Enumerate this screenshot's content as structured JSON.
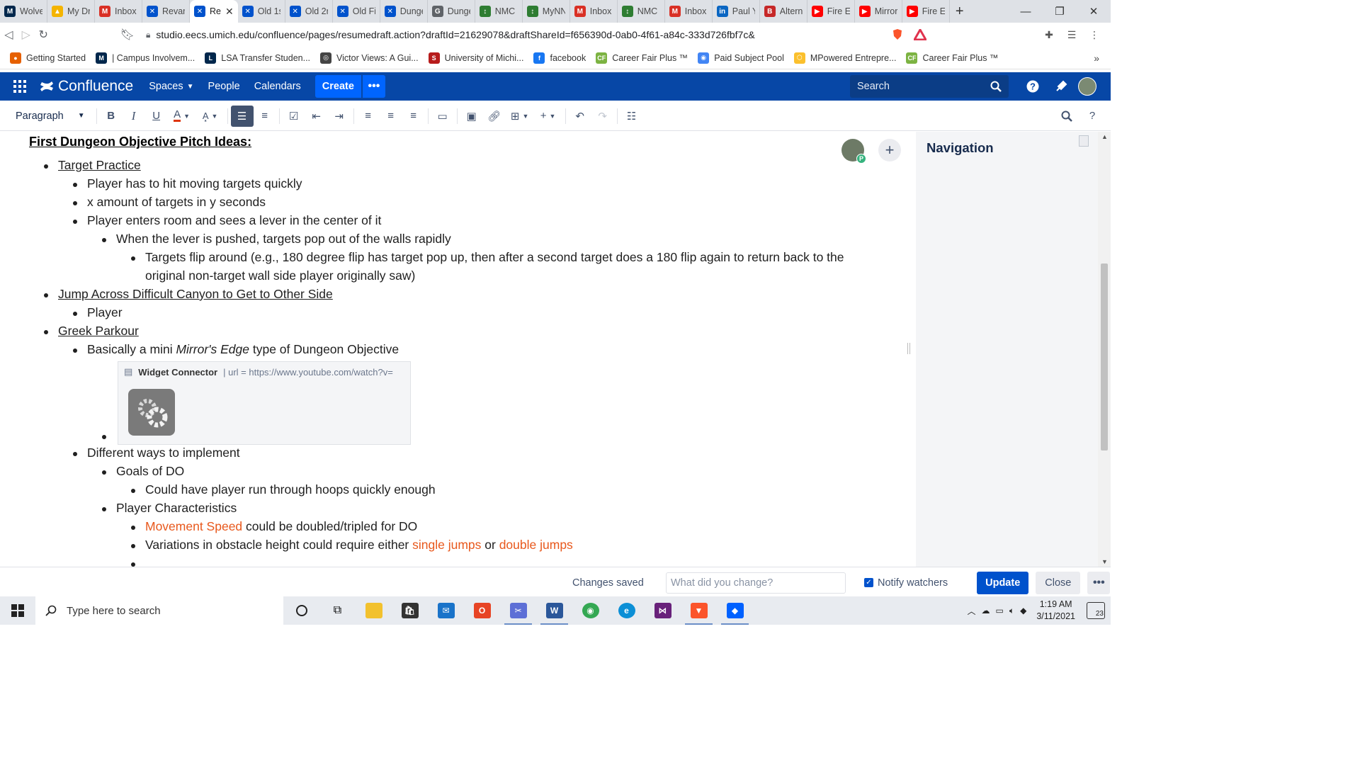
{
  "browser": {
    "tabs": [
      {
        "label": "Wolve",
        "icon": "michigan-icon",
        "color": "#00274c",
        "glyph": "M"
      },
      {
        "label": "My Dr",
        "icon": "drive-icon",
        "color": "#f4b400",
        "glyph": "▲"
      },
      {
        "label": "Inbox",
        "icon": "gmail-icon",
        "color": "#d93025",
        "glyph": "M"
      },
      {
        "label": "Revam",
        "icon": "confluence-icon",
        "color": "#0052cc",
        "glyph": "✕"
      },
      {
        "label": "Re",
        "icon": "confluence-icon",
        "color": "#0052cc",
        "glyph": "✕",
        "active": true
      },
      {
        "label": "Old 1s",
        "icon": "confluence-icon",
        "color": "#0052cc",
        "glyph": "✕"
      },
      {
        "label": "Old 2r",
        "icon": "confluence-icon",
        "color": "#0052cc",
        "glyph": "✕"
      },
      {
        "label": "Old Fi",
        "icon": "confluence-icon",
        "color": "#0052cc",
        "glyph": "✕"
      },
      {
        "label": "Dunge",
        "icon": "confluence-icon",
        "color": "#0052cc",
        "glyph": "✕"
      },
      {
        "label": "Dunge",
        "icon": "google-icon",
        "color": "#5f6368",
        "glyph": "G"
      },
      {
        "label": "NMC",
        "icon": "nmc-icon",
        "color": "#2e7d32",
        "glyph": "↕"
      },
      {
        "label": "MyNN",
        "icon": "nmc-icon",
        "color": "#2e7d32",
        "glyph": "↕"
      },
      {
        "label": "Inbox",
        "icon": "gmail-icon",
        "color": "#d93025",
        "glyph": "M"
      },
      {
        "label": "NMC",
        "icon": "nmc-icon",
        "color": "#2e7d32",
        "glyph": "↕"
      },
      {
        "label": "Inbox",
        "icon": "gmail-icon",
        "color": "#d93025",
        "glyph": "M"
      },
      {
        "label": "Paul Y",
        "icon": "linkedin-icon",
        "color": "#0a66c2",
        "glyph": "in"
      },
      {
        "label": "Altern",
        "icon": "b-icon",
        "color": "#c62828",
        "glyph": "B"
      },
      {
        "label": "Fire Er",
        "icon": "youtube-icon",
        "color": "#ff0000",
        "glyph": "▶"
      },
      {
        "label": "Mirror",
        "icon": "youtube-icon",
        "color": "#ff0000",
        "glyph": "▶"
      },
      {
        "label": "Fire Er",
        "icon": "youtube-icon",
        "color": "#ff0000",
        "glyph": "▶"
      }
    ],
    "url": "studio.eecs.umich.edu/confluence/pages/resumedraft.action?draftId=21629078&draftShareId=f656390d-0ab0-4f61-a84c-333d726fbf7c&",
    "brave_badge": "6",
    "bookmarks": [
      {
        "label": "Getting Started",
        "icon": "firefox-icon",
        "color": "#e66000",
        "glyph": "●"
      },
      {
        "label": "| Campus Involvem...",
        "icon": "michigan-icon",
        "color": "#00274c",
        "glyph": "M"
      },
      {
        "label": "LSA Transfer Studen...",
        "icon": "lsa-icon",
        "color": "#00274c",
        "glyph": "L"
      },
      {
        "label": "Victor Views: A Gui...",
        "icon": "globe-icon",
        "color": "#444444",
        "glyph": "◎"
      },
      {
        "label": "University of Michi...",
        "icon": "umich-icon",
        "color": "#b71c1c",
        "glyph": "S"
      },
      {
        "label": "facebook",
        "icon": "facebook-icon",
        "color": "#1877f2",
        "glyph": "f"
      },
      {
        "label": "Career Fair Plus ™",
        "icon": "careerfair-icon",
        "color": "#7cb342",
        "glyph": "CF"
      },
      {
        "label": "Paid Subject Pool",
        "icon": "chrome-icon",
        "color": "#4285f4",
        "glyph": "◉"
      },
      {
        "label": "MPowered Entrepre...",
        "icon": "hexagon-icon",
        "color": "#fbc02d",
        "glyph": "⬡"
      },
      {
        "label": "Career Fair Plus ™",
        "icon": "careerfair-icon",
        "color": "#7cb342",
        "glyph": "CF"
      }
    ]
  },
  "confluence": {
    "brand": "Confluence",
    "nav": {
      "spaces": "Spaces",
      "people": "People",
      "calendars": "Calendars"
    },
    "create": "Create",
    "search_placeholder": "Search"
  },
  "toolbar": {
    "paragraph_style": "Paragraph"
  },
  "editor": {
    "heading": "First Dungeon Objective Pitch Ideas:",
    "collaborator_badge": "P",
    "items": [
      {
        "level": 1,
        "segments": [
          {
            "text": "Target Practice",
            "style": "u"
          }
        ]
      },
      {
        "level": 2,
        "segments": [
          {
            "text": "Player has to hit moving targets quickly"
          }
        ]
      },
      {
        "level": 2,
        "segments": [
          {
            "text": "x amount of targets in y seconds"
          }
        ]
      },
      {
        "level": 2,
        "segments": [
          {
            "text": "Player enters room and sees a lever in the center of it"
          }
        ]
      },
      {
        "level": 3,
        "segments": [
          {
            "text": "When the lever is pushed, targets pop out of the walls rapidly"
          }
        ]
      },
      {
        "level": 4,
        "segments": [
          {
            "text": "Targets flip around (e.g., 180 degree flip has target pop up, then after a second target does a 180 flip again to return back to the"
          }
        ]
      },
      {
        "level": 4,
        "continuation": true,
        "segments": [
          {
            "text": "original non-target wall side player originally saw)"
          }
        ]
      },
      {
        "level": 1,
        "segments": [
          {
            "text": "Jump Across Difficult Canyon to Get to Other Side",
            "style": "u"
          }
        ]
      },
      {
        "level": 2,
        "segments": [
          {
            "text": "Player"
          }
        ]
      },
      {
        "level": 1,
        "segments": [
          {
            "text": "Greek Parkour",
            "style": "u"
          }
        ]
      },
      {
        "level": 2,
        "segments": [
          {
            "text": "Basically a mini "
          },
          {
            "text": "Mirror's Edge",
            "style": "i"
          },
          {
            "text": " type of Dungeon Objective"
          }
        ]
      },
      {
        "level": 2,
        "segments": [
          {
            "text": "Different ways to implement"
          }
        ]
      },
      {
        "level": 3,
        "segments": [
          {
            "text": "Goals of DO"
          }
        ]
      },
      {
        "level": 4,
        "segments": [
          {
            "text": "Could have player run through hoops quickly enough"
          }
        ]
      },
      {
        "level": 3,
        "segments": [
          {
            "text": "Player Characteristics"
          }
        ]
      },
      {
        "level": 4,
        "segments": [
          {
            "text": "Movement Speed",
            "style": "orange"
          },
          {
            "text": " could be doubled/tripled for DO"
          }
        ]
      },
      {
        "level": 4,
        "segments": [
          {
            "text": "Variations in obstacle height could require either "
          },
          {
            "text": "single jumps",
            "style": "orange"
          },
          {
            "text": " or "
          },
          {
            "text": "double jumps",
            "style": "orange"
          }
        ]
      },
      {
        "level": 4,
        "segments": []
      }
    ],
    "widget": {
      "title": "Widget Connector",
      "url": "| url = https://www.youtube.com/watch?v="
    }
  },
  "sidebar": {
    "title": "Navigation"
  },
  "footer": {
    "status": "Changes saved",
    "change_placeholder": "What did you change?",
    "notify_label": "Notify watchers",
    "update": "Update",
    "close": "Close"
  },
  "taskbar": {
    "search_placeholder": "Type here to search",
    "time": "1:19 AM",
    "date": "3/11/2021",
    "notifications": "23"
  }
}
